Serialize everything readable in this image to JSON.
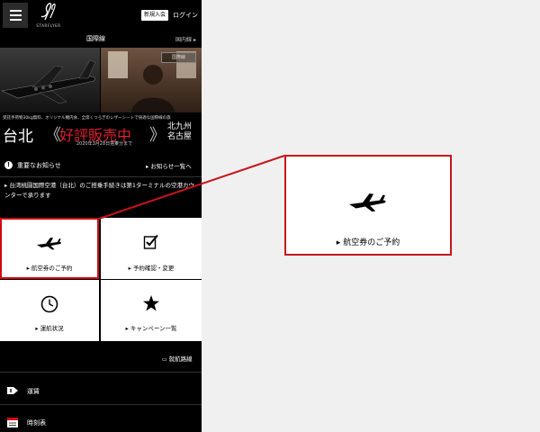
{
  "header": {
    "logo_text": "STARFLYER",
    "new_user_label": "新規入会",
    "login_label": "ログイン"
  },
  "tabs": {
    "international_label": "国際線",
    "domestic_label": "国内線"
  },
  "banner": {
    "badge": "国際線",
    "description": "受託手荷物30kg無料、オリジナル機内食、全席くつろぎのレザーシートで快適な国際線の旅",
    "city_from": "台北",
    "mark_open": "《",
    "sale_text": "好評販売中",
    "mark_close": "》",
    "city_to_1": "北九州",
    "city_to_2": "名古屋",
    "date_text": "2020年3月28日搭乗分まで"
  },
  "notices": {
    "title": "重要なお知らせ",
    "view_all": "お知らせ一覧へ",
    "items": [
      "台湾桃園国際空港（台北）のご搭乗手続きは第1ターミナルの空港カウンターで承ります"
    ]
  },
  "tiles": [
    {
      "label": "航空券のご予約",
      "icon": "airplane-icon"
    },
    {
      "label": "予約確認・変更",
      "icon": "checklist-icon"
    },
    {
      "label": "運航状況",
      "icon": "clock-icon"
    },
    {
      "label": "キャンペーン一覧",
      "icon": "star-icon"
    }
  ],
  "routes_link": "就航路線",
  "list": [
    {
      "label": "運賃",
      "icon": "fare-icon"
    },
    {
      "label": "時刻表",
      "icon": "timetable-icon"
    }
  ],
  "zoom": {
    "label": "航空券のご予約",
    "icon": "airplane-icon"
  },
  "colors": {
    "accent_red": "#d10a10",
    "background": "#000000",
    "tile_background": "#ffffff"
  }
}
